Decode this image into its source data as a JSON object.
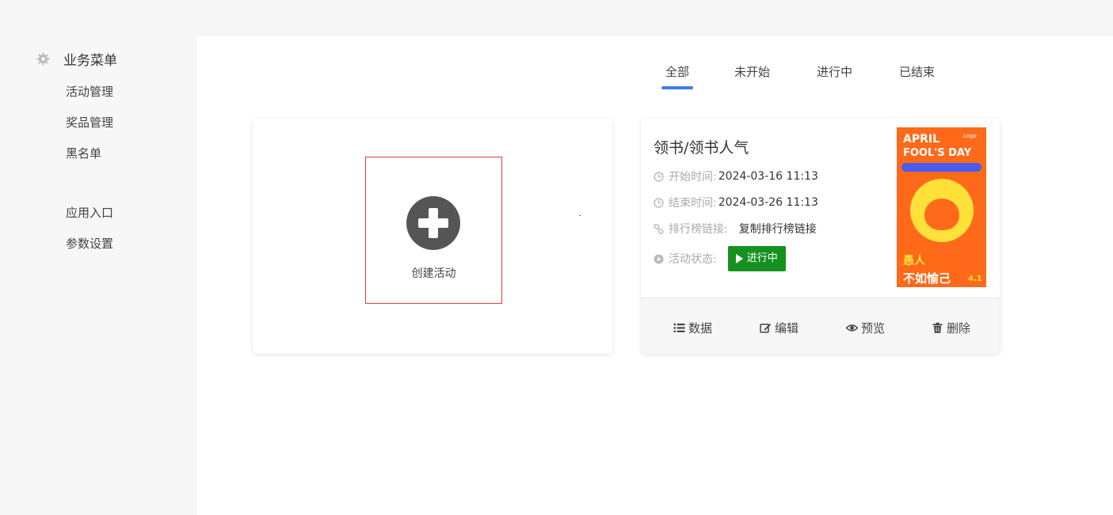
{
  "sidebar": {
    "header": {
      "icon": "gear-icon",
      "title": "业务菜单"
    },
    "items": [
      {
        "label": "活动管理"
      },
      {
        "label": "奖品管理"
      },
      {
        "label": "黑名单"
      },
      {
        "label": "应用入口"
      },
      {
        "label": "参数设置"
      }
    ]
  },
  "tabs": [
    {
      "label": "全部",
      "active": true
    },
    {
      "label": "未开始",
      "active": false
    },
    {
      "label": "进行中",
      "active": false
    },
    {
      "label": "已结束",
      "active": false
    }
  ],
  "create": {
    "label": "创建活动",
    "icon": "plus-circle-icon"
  },
  "activity": {
    "title": "领书/领书人气",
    "start_label": "开始时间:",
    "start_value": "2024-03-16 11:13",
    "end_label": "结束时间:",
    "end_value": "2024-03-26 11:13",
    "rank_label": "排行榜链接:",
    "rank_link": "复制排行榜链接",
    "status_label": "活动状态:",
    "status_value": "进行中",
    "poster": {
      "line1": "APRIL",
      "line2": "FOOL'S DAY",
      "logo": "Logo",
      "bottom_left": "愚人",
      "bottom_big": "不如愉己",
      "date": "4.1"
    },
    "actions": [
      {
        "label": "数据",
        "icon": "list-icon"
      },
      {
        "label": "编辑",
        "icon": "edit-icon"
      },
      {
        "label": "预览",
        "icon": "eye-icon"
      },
      {
        "label": "删除",
        "icon": "trash-icon"
      }
    ]
  },
  "colors": {
    "accent": "#3d7fe8",
    "status_green": "#16911f",
    "create_border": "#e03c3c",
    "poster_bg": "#ff6a1a"
  }
}
